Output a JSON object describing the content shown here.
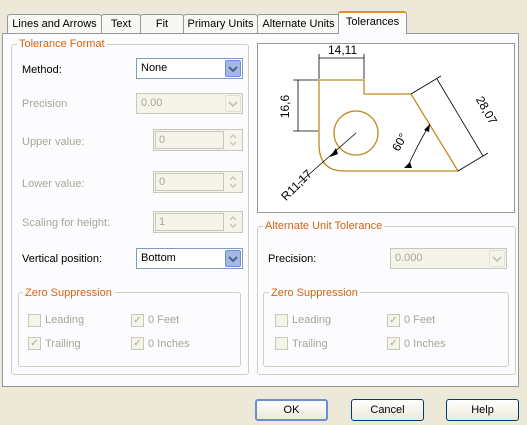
{
  "tabs": [
    "Lines and Arrows",
    "Text",
    "Fit",
    "Primary Units",
    "Alternate Units",
    "Tolerances"
  ],
  "tolerance_format": {
    "title": "Tolerance Format",
    "method": {
      "label": "Method:",
      "value": "None"
    },
    "precision": {
      "label": "Precision",
      "value": "0.00"
    },
    "upper_value": {
      "label": "Upper value:",
      "value": "0"
    },
    "lower_value": {
      "label": "Lower value:",
      "value": "0"
    },
    "scaling_for_height": {
      "label": "Scaling for height:",
      "value": "1"
    },
    "vertical_position": {
      "label": "Vertical position:",
      "value": "Bottom"
    }
  },
  "zero_suppression_left": {
    "title": "Zero Suppression",
    "leading": {
      "label": "Leading",
      "checked": false
    },
    "trailing": {
      "label": "Trailing",
      "checked": true
    },
    "zero_feet": {
      "label": "0 Feet",
      "checked": true
    },
    "zero_inches": {
      "label": "0 Inches",
      "checked": true
    }
  },
  "preview": {
    "dim_top": "14,11",
    "dim_left": "16,6",
    "dim_right": "28,07",
    "dim_angle": "60°",
    "dim_radius": "R11,17"
  },
  "alternate_unit_tolerance": {
    "title": "Alternate Unit Tolerance",
    "precision": {
      "label": "Precision:",
      "value": "0.000"
    }
  },
  "zero_suppression_right": {
    "title": "Zero Suppression",
    "leading": {
      "label": "Leading",
      "checked": false
    },
    "trailing": {
      "label": "Trailing",
      "checked": false
    },
    "zero_feet": {
      "label": "0 Feet",
      "checked": true
    },
    "zero_inches": {
      "label": "0 Inches",
      "checked": true
    }
  },
  "buttons": {
    "ok": "OK",
    "cancel": "Cancel",
    "help": "Help"
  },
  "colors": {
    "accent_orange": "#d6620e",
    "tab_highlight": "#e68b2c",
    "preview_outline": "#c08a1c"
  },
  "icons": {
    "checkmark": "✓",
    "dropdown": "chevron-down-icon",
    "spin": "spin-arrows-icon"
  }
}
